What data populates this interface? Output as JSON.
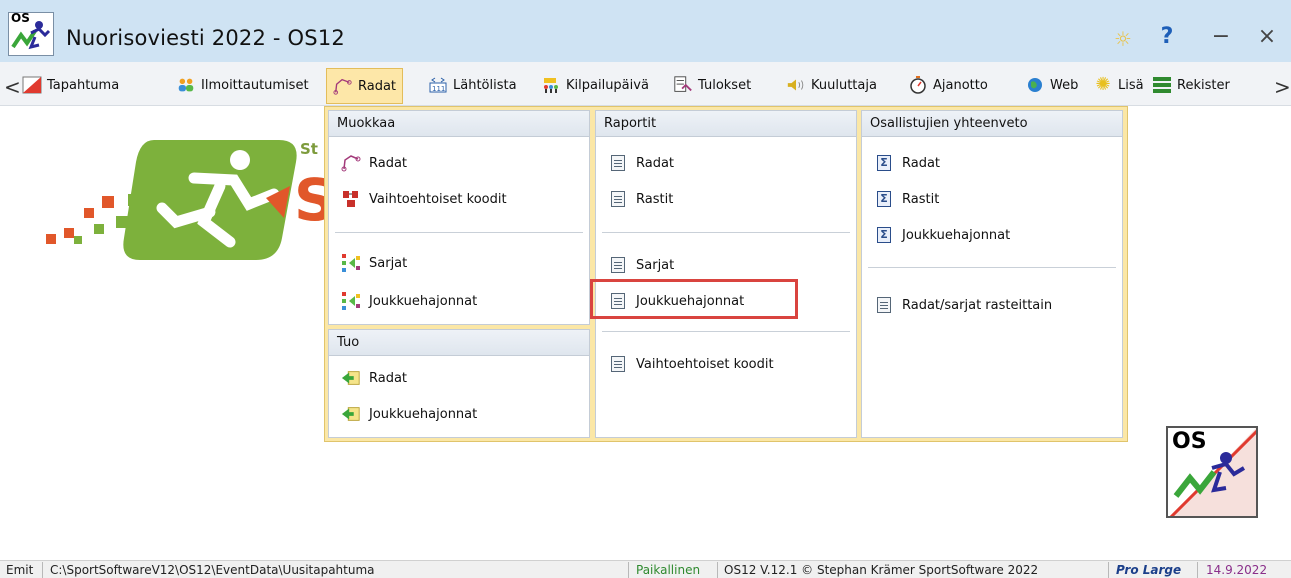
{
  "window": {
    "title": "Nuorisoviesti 2022  -  OS12",
    "icon_text": "OS",
    "controls": {
      "settings": "☼",
      "help": "?",
      "minimize": "−",
      "close": "×"
    }
  },
  "menubar": {
    "nav_left": "<",
    "nav_right": ">",
    "items": [
      {
        "label": "Tapahtuma",
        "icon": "event-flag-icon"
      },
      {
        "label": "Ilmoittautumiset",
        "icon": "people-icon"
      },
      {
        "label": "Radat",
        "icon": "course-icon",
        "active": true
      },
      {
        "label": "Lähtölista",
        "icon": "start-list-icon"
      },
      {
        "label": "Kilpailupäivä",
        "icon": "competition-day-icon"
      },
      {
        "label": "Tulokset",
        "icon": "results-icon"
      },
      {
        "label": "Kuuluttaja",
        "icon": "speaker-icon"
      },
      {
        "label": "Ajanotto",
        "icon": "stopwatch-icon"
      },
      {
        "label": "Web",
        "icon": "globe-icon"
      },
      {
        "label": "Lisä",
        "icon": "gear-icon"
      },
      {
        "label": "Rekister",
        "icon": "register-icon"
      }
    ]
  },
  "dropdown": {
    "muokkaa": {
      "header": "Muokkaa",
      "items": [
        "Radat",
        "Vaihtoehtoiset koodit",
        "Sarjat",
        "Joukkuehajonnat"
      ]
    },
    "tuo": {
      "header": "Tuo",
      "items": [
        "Radat",
        "Joukkuehajonnat"
      ]
    },
    "raportit": {
      "header": "Raportit",
      "items": [
        "Radat",
        "Rastit",
        "Sarjat",
        "Joukkuehajonnat",
        "Vaihtoehtoiset koodit"
      ]
    },
    "yhteenveto": {
      "header": "Osallistujien yhteenveto",
      "items": [
        "Radat",
        "Rastit",
        "Joukkuehajonnat",
        "Radat/sarjat rasteittain"
      ]
    }
  },
  "background": {
    "logo_text_small": "St",
    "logo_text_large": "S",
    "os_badge_text": "OS"
  },
  "statusbar": {
    "emit": "Emit",
    "path": "C:\\SportSoftwareV12\\OS12\\EventData\\Uusitapahtuma",
    "mode": "Paikallinen",
    "version": "OS12 V.12.1 © Stephan Krämer SportSoftware 2022",
    "edition": "Pro Large",
    "date": "14.9.2022"
  },
  "colors": {
    "titlebar": "#cfe3f3",
    "dropdown_bg": "#fbe7a6",
    "highlight": "#d9443f",
    "status_mode": "#2f8a2f",
    "status_edition": "#1b3f8a",
    "status_date": "#8a2f8a"
  }
}
